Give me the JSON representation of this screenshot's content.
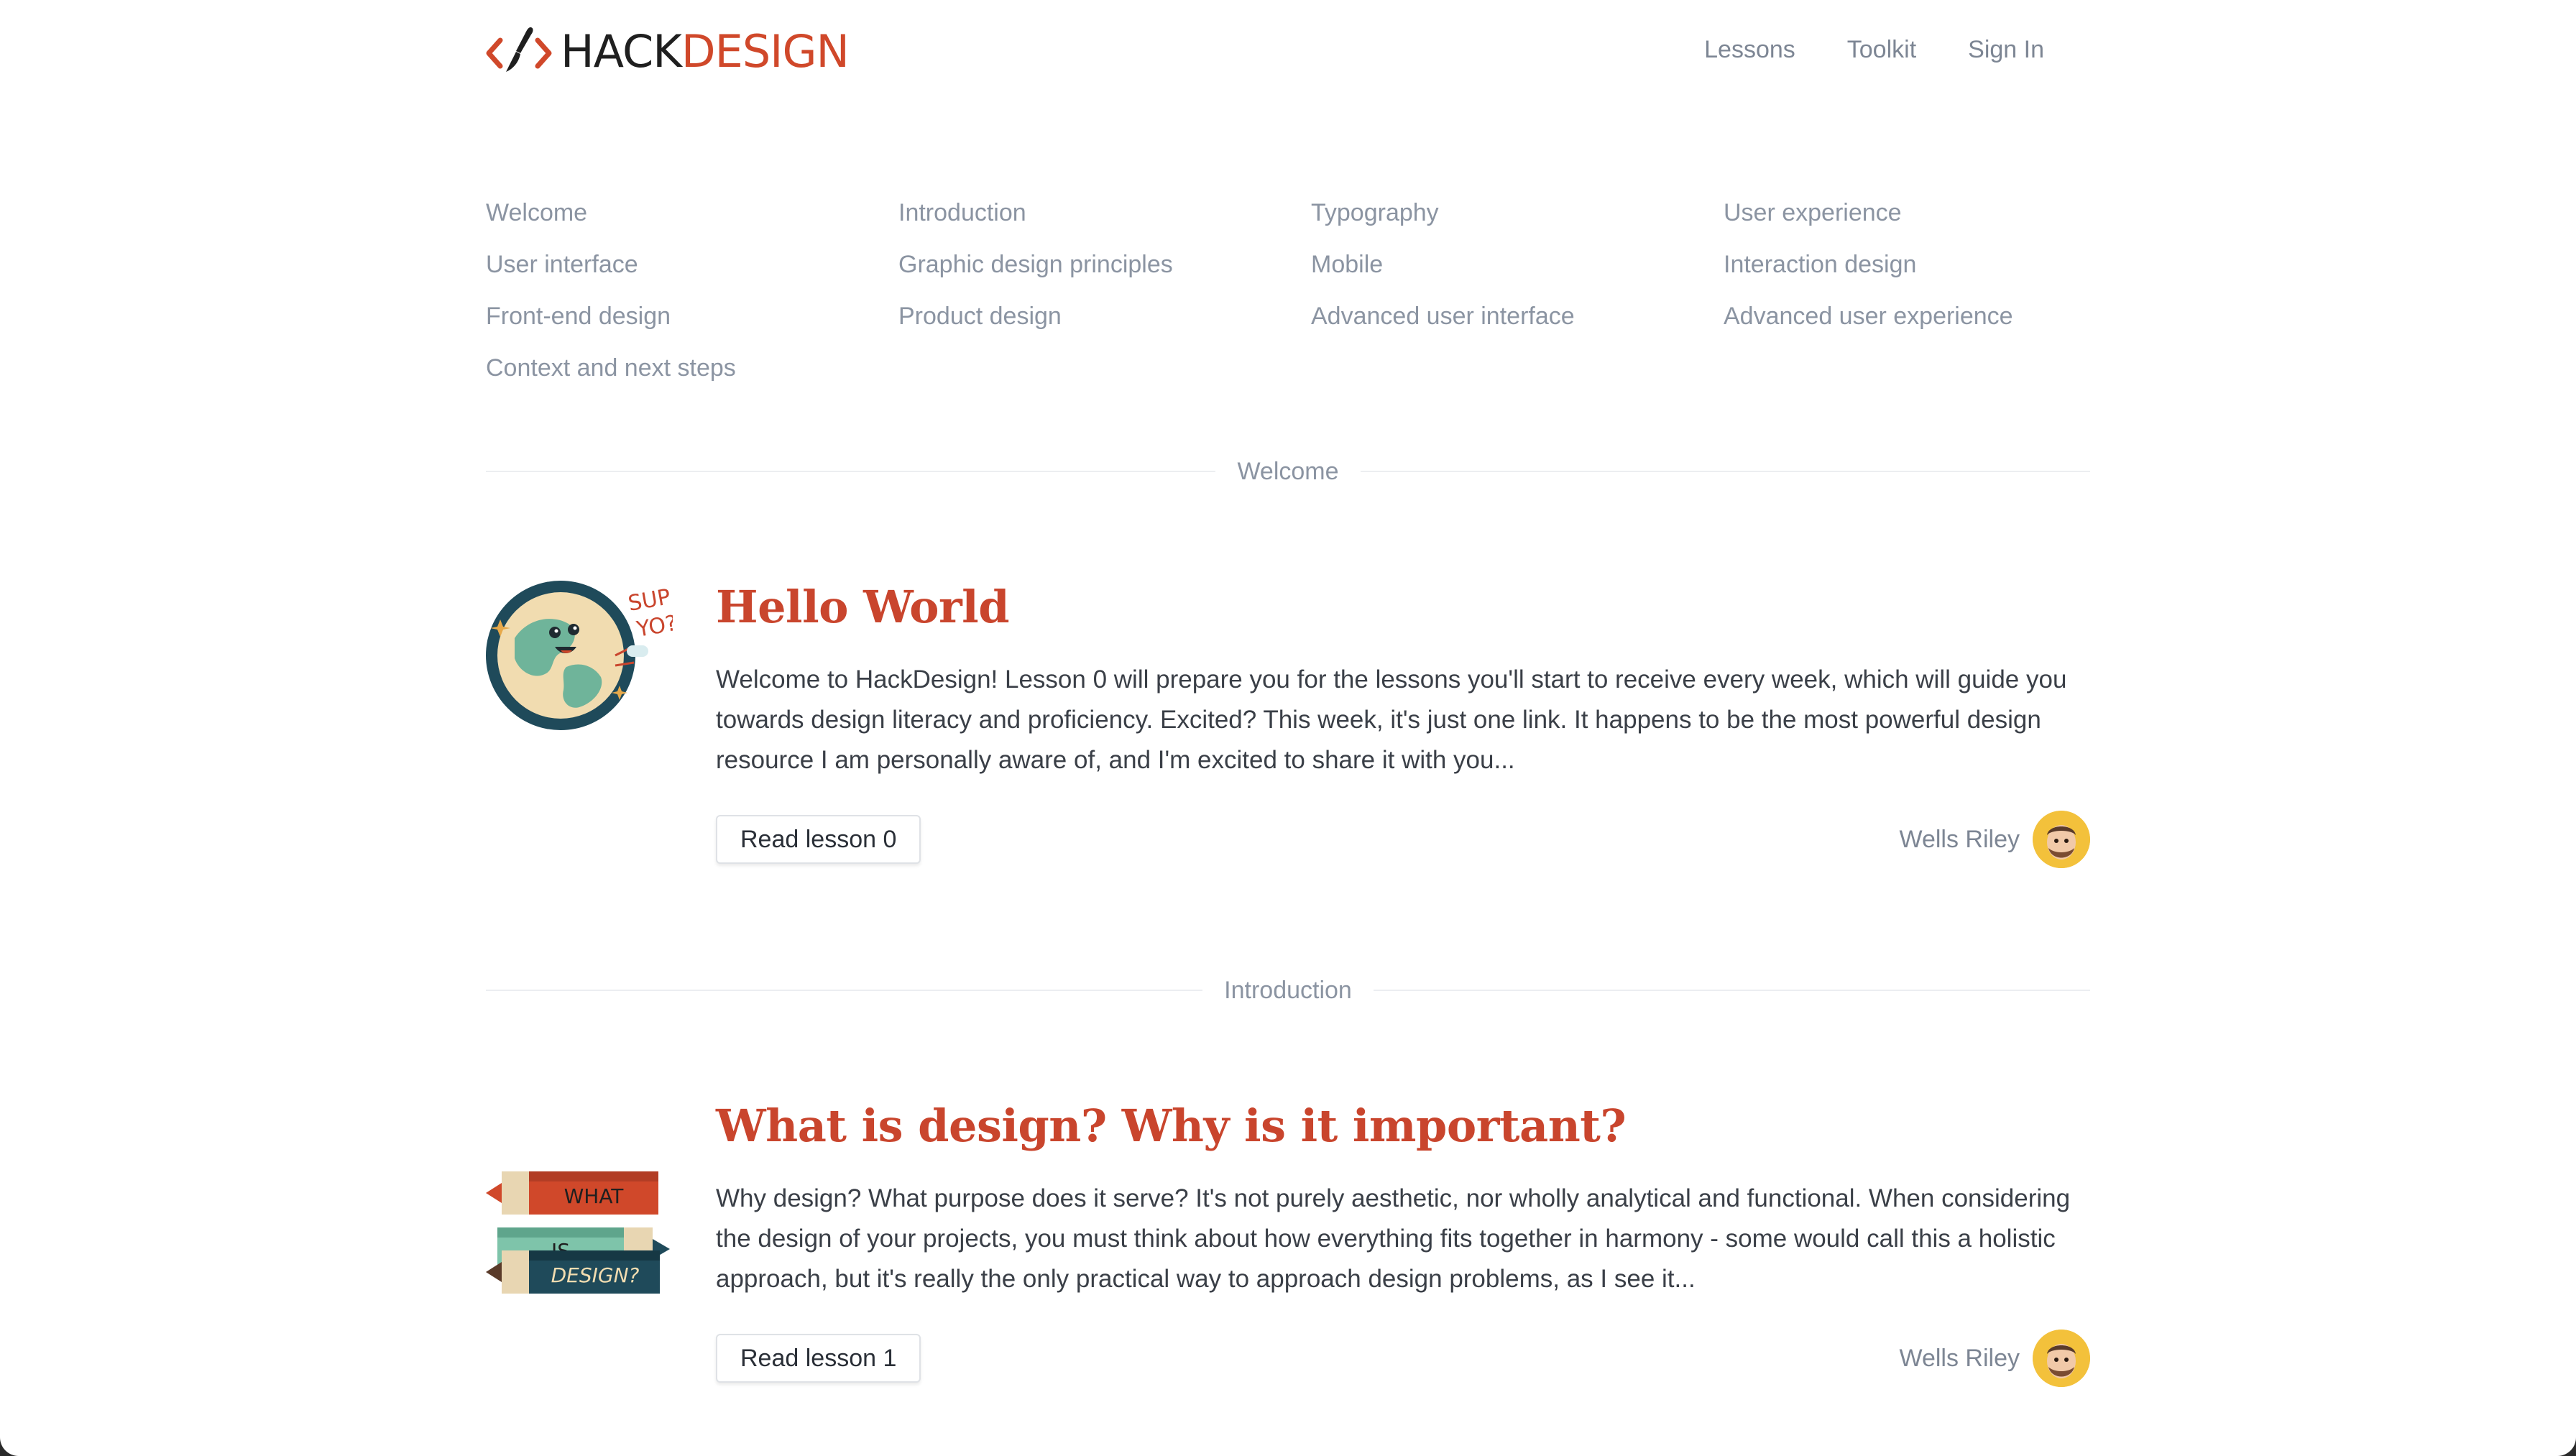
{
  "brand": {
    "logo_part1": "HACK",
    "logo_part2": "DESIGN",
    "accent": "#d0482a"
  },
  "nav": {
    "items": [
      "Lessons",
      "Toolkit",
      "Sign In"
    ]
  },
  "topics": [
    "Welcome",
    "Introduction",
    "Typography",
    "User experience",
    "User interface",
    "Graphic design principles",
    "Mobile",
    "Interaction design",
    "Front-end design",
    "Product design",
    "Advanced user interface",
    "Advanced user experience",
    "Context and next steps"
  ],
  "sections": [
    {
      "heading": "Welcome",
      "lesson": {
        "title": "Hello World",
        "description": "Welcome to HackDesign! Lesson 0 will prepare you for the lessons you'll start to receive every week, which will guide you towards design literacy and proficiency. Excited? This week, it's just one link. It happens to be the most powerful design resource I am personally aware of, and I'm excited to share it with you...",
        "button": "Read lesson 0",
        "author": "Wells Riley",
        "illustration_text": [
          "SUP",
          "YO?"
        ]
      }
    },
    {
      "heading": "Introduction",
      "lesson": {
        "title": "What is design? Why is it important?",
        "description": "Why design? What purpose does it serve? It's not purely aesthetic, nor wholly analytical and functional. When considering the design of your projects, you must think about how everything fits together in harmony - some would call this a holistic approach, but it's really the only practical way to approach design problems, as I see it...",
        "button": "Read lesson 1",
        "author": "Wells Riley",
        "illustration_text": [
          "WHAT",
          "IS",
          "DESIGN?"
        ]
      }
    }
  ]
}
